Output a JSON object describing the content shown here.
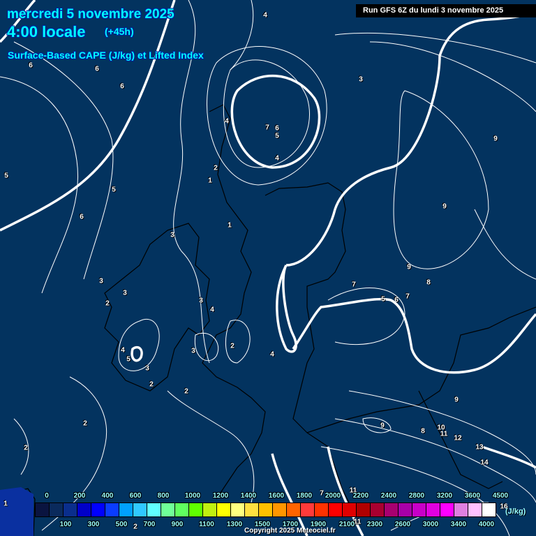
{
  "header": {
    "date": "mercredi 5 novembre 2025",
    "time": "4:00 locale",
    "lead": "(+45h)",
    "parameter": "Surface-Based CAPE (J/kg) et Lifted Index",
    "run": "Run GFS 6Z du lundi 3 novembre 2025"
  },
  "contour_labels": [
    "4",
    "6",
    "6",
    "6",
    "3",
    "7",
    "6",
    "5",
    "4",
    "4",
    "9",
    "5",
    "5",
    "2",
    "1",
    "6",
    "1",
    "9",
    "3",
    "9",
    "8",
    "3",
    "3",
    "2",
    "3",
    "4",
    "7",
    "5",
    "6",
    "7",
    "2",
    "3",
    "4",
    "5",
    "3",
    "4",
    "2",
    "2",
    "9",
    "9",
    "8",
    "10",
    "11",
    "12",
    "2",
    "13",
    "2",
    "14",
    "7",
    "11",
    "16",
    "1",
    "2",
    "11"
  ],
  "legend": {
    "unit": "(J/kg)",
    "top_labels": [
      "0",
      "200",
      "400",
      "600",
      "800",
      "1000",
      "1200",
      "1400",
      "1600",
      "1800",
      "2000",
      "2200",
      "2400",
      "2800",
      "3200",
      "3600",
      "4500"
    ],
    "bottom_labels": [
      "100",
      "300",
      "500",
      "700",
      "900",
      "1100",
      "1300",
      "1500",
      "1700",
      "1900",
      "2100",
      "2300",
      "2600",
      "3000",
      "3400",
      "4000"
    ],
    "colors": [
      "#0a1440",
      "#0a2a5c",
      "#0a2e8c",
      "#0000c8",
      "#0000ff",
      "#0a3cff",
      "#00a0ff",
      "#30c8ff",
      "#60ffff",
      "#70ff98",
      "#60ff60",
      "#60ff00",
      "#c0f010",
      "#ffff00",
      "#ffff80",
      "#ffe040",
      "#ffc000",
      "#ff9600",
      "#ff6400",
      "#ff3a3a",
      "#ff3200",
      "#ff0000",
      "#e00000",
      "#b00000",
      "#a80030",
      "#a80070",
      "#a800a8",
      "#c800c8",
      "#e000e0",
      "#ff00ff",
      "#e080e0",
      "#ffc0ff",
      "#ffffff"
    ]
  },
  "copyright": "Copyright 2025 Meteociel.fr"
}
